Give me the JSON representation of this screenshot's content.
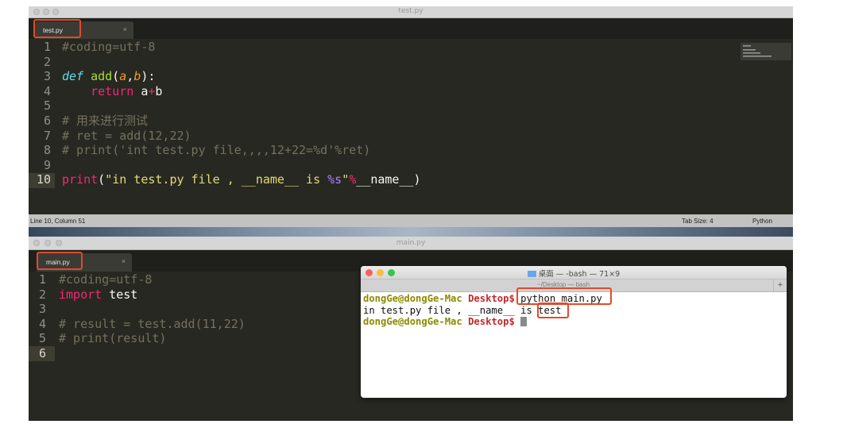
{
  "window1": {
    "title": "test.py",
    "tab": {
      "label": "test.py",
      "close": "×"
    },
    "lines": [
      "1",
      "2",
      "3",
      "4",
      "5",
      "6",
      "7",
      "8",
      "9",
      "10"
    ],
    "code": {
      "l1": "#coding=utf-8",
      "l3_def": "def",
      "l3_fn": "add",
      "l3_open": "(",
      "l3_a": "a",
      "l3_comma": ",",
      "l3_b": "b",
      "l3_close": "):",
      "l4_indent": "    ",
      "l4_return": "return",
      "l4_a": " a",
      "l4_plus": "+",
      "l4_b": "b",
      "l6": "# 用来进行测试",
      "l7": "# ret = add(12,22)",
      "l8": "# print('int test.py file,,,,12+22=%d'%ret)",
      "l10_print": "print",
      "l10_open": "(",
      "l10_str1": "\"in test.py file , __name__ is ",
      "l10_fmt": "%s",
      "l10_str2": "\"",
      "l10_op": "%",
      "l10_rest": "__name__)"
    },
    "status": {
      "position": "Line 10, Column 51",
      "tab_size": "Tab Size: 4",
      "syntax": "Python"
    }
  },
  "window2": {
    "title": "main.py",
    "tab": {
      "label": "main.py",
      "close": "×"
    },
    "lines": [
      "1",
      "2",
      "3",
      "4",
      "5",
      "6"
    ],
    "code": {
      "l1": "#coding=utf-8",
      "l2_kw": "import",
      "l2_rest": " test",
      "l4": "# result = test.add(11,22)",
      "l5": "# print(result)"
    }
  },
  "terminal": {
    "title": "桌面 — -bash — 71×9",
    "tab_path": "~/Desktop — bash",
    "plus": "+",
    "prompt_user": "dongGe@dongGe-Mac",
    "prompt_dir": "Desktop$",
    "command": " python main.py",
    "output_prefix": "in test.py file , __name__ is ",
    "output_value": "test"
  },
  "colors": {
    "editor_bg": "#272822",
    "highlight": "#e24a2b",
    "keyword": "#f92672",
    "function": "#a6e22e",
    "string": "#e6db74"
  }
}
